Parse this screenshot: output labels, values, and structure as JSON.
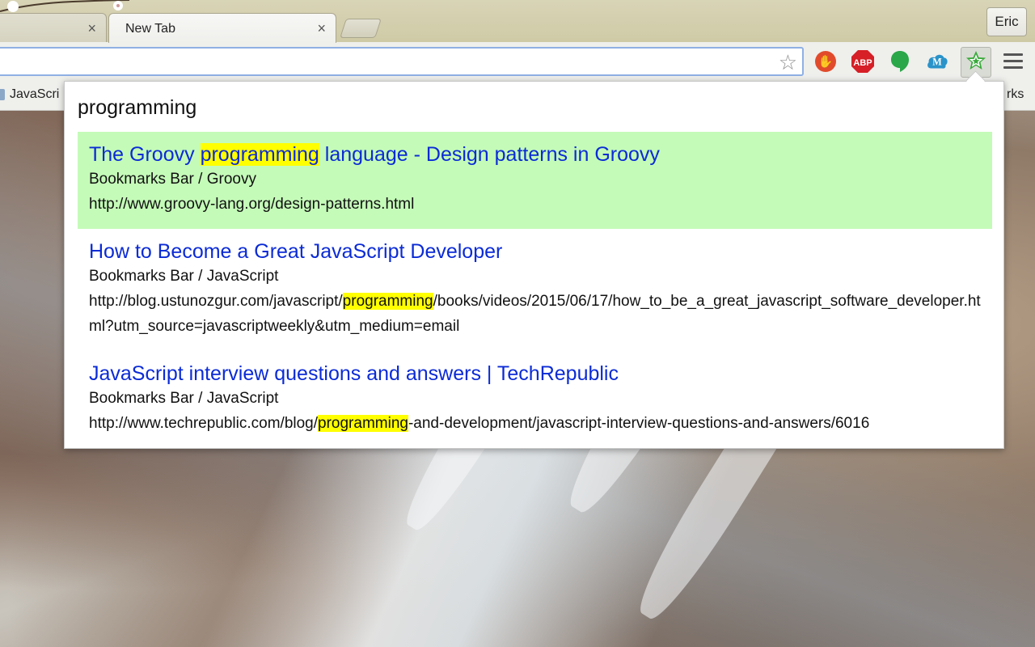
{
  "browser": {
    "tabs": [
      {
        "title": "",
        "close": "×"
      },
      {
        "title": "New Tab",
        "close": "×"
      }
    ],
    "profile_name": "Eric",
    "omnibox_value": ""
  },
  "extensions": [
    {
      "name": "hand-stop-icon",
      "color": "#e14b2b",
      "glyph": "✋"
    },
    {
      "name": "adblock-plus-icon",
      "color": "#d61f26",
      "glyph": "ABP"
    },
    {
      "name": "hangouts-icon",
      "color": "#2aa748",
      "glyph": ""
    },
    {
      "name": "mailbox-cloud-icon",
      "color": "#2a93c9",
      "glyph": "M"
    },
    {
      "name": "bookmark-search-star-icon",
      "color": "#38a93a",
      "glyph": "☆"
    }
  ],
  "bookmarks_bar": {
    "left_label": "JavaScri",
    "right_label": "rks"
  },
  "search": {
    "query": "programming",
    "results": [
      {
        "title_before": "The Groovy ",
        "title_match": "programming",
        "title_after": " language - Design patterns in Groovy",
        "path": "Bookmarks Bar / Groovy",
        "url_before": "http://www.groovy-lang.org/design-patterns.html",
        "url_match": "",
        "url_after": ""
      },
      {
        "title_before": "How to Become a Great JavaScript Developer",
        "title_match": "",
        "title_after": "",
        "path": "Bookmarks Bar / JavaScript",
        "url_before": "http://blog.ustunozgur.com/javascript/",
        "url_match": "programming",
        "url_after": "/books/videos/2015/06/17/how_to_be_a_great_javascript_software_developer.html?utm_source=javascriptweekly&utm_medium=email"
      },
      {
        "title_before": "JavaScript interview questions and answers | TechRepublic",
        "title_match": "",
        "title_after": "",
        "path": "Bookmarks Bar / JavaScript",
        "url_before": "http://www.techrepublic.com/blog/",
        "url_match": "programming",
        "url_after": "-and-development/javascript-interview-questions-and-answers/6016"
      }
    ]
  },
  "colors": {
    "selected_row": "#c4fbb8",
    "highlight": "#ffff00",
    "link": "#0b2bd6"
  }
}
